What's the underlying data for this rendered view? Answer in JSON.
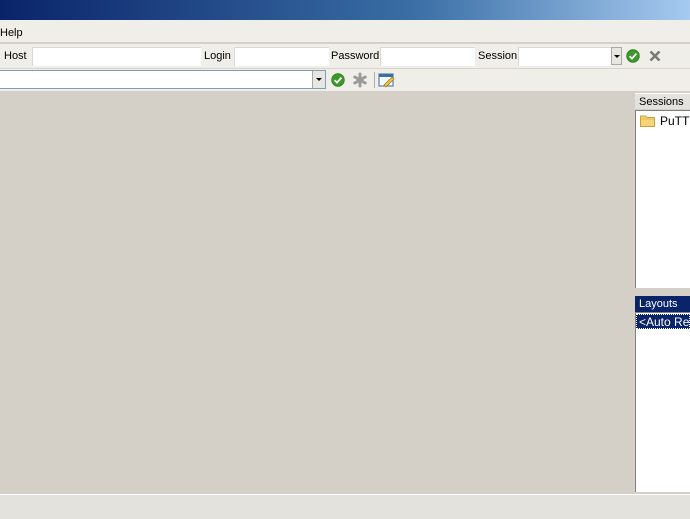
{
  "menu": {
    "help": "Help"
  },
  "toolbar": {
    "host_label": "Host",
    "host_value": "",
    "login_label": "Login",
    "login_value": "",
    "password_label": "Password",
    "password_value": "",
    "session_label": "Session",
    "session_value": ""
  },
  "command_bar": {
    "value": ""
  },
  "sessions": {
    "title": "Sessions",
    "items": [
      {
        "label": "PuTTY"
      }
    ]
  },
  "layouts": {
    "title": "Layouts",
    "items": [
      {
        "label": "<Auto Resize>"
      }
    ]
  },
  "colors": {
    "title_gradient_start": "#0a246a",
    "title_gradient_end": "#a6caf0",
    "panel_bg": "#d4d0c8",
    "selection": "#0a246a",
    "ok_green": "#3a9a2a"
  }
}
